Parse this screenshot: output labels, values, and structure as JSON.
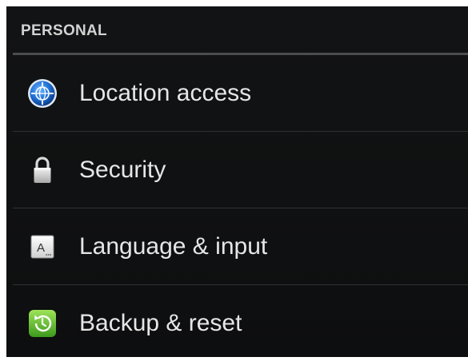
{
  "section": {
    "title": "PERSONAL"
  },
  "items": [
    {
      "label": "Location access",
      "icon": "location-globe-icon"
    },
    {
      "label": "Security",
      "icon": "lock-icon"
    },
    {
      "label": "Language & input",
      "icon": "keyboard-a-icon"
    },
    {
      "label": "Backup & reset",
      "icon": "backup-restore-icon"
    }
  ],
  "colors": {
    "background": "#101112",
    "header_text": "#d2d2d2",
    "item_text": "#e6e6e6",
    "divider": "#2f3133",
    "header_rule": "#4a4c4e",
    "location_icon": "#1e6fd6",
    "backup_icon": "#5cb82e"
  }
}
